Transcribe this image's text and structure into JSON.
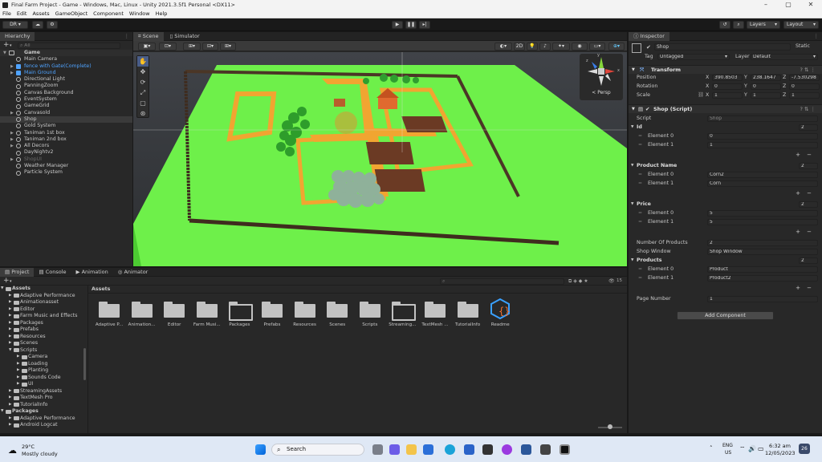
{
  "window": {
    "title": "Final Farm Project - Game - Windows, Mac, Linux - Unity 2021.3.5f1 Personal <DX11>"
  },
  "menu": [
    "File",
    "Edit",
    "Assets",
    "GameObject",
    "Component",
    "Window",
    "Help"
  ],
  "toolbar": {
    "account": "DR",
    "layers": "Layers",
    "layout": "Layout"
  },
  "hierarchy": {
    "tab": "Hierarchy",
    "search_placeholder": "All",
    "scene": "Game",
    "items": [
      {
        "label": "Main Camera",
        "style": "normal",
        "arrow": false
      },
      {
        "label": "fence with Gate(Complete)",
        "style": "blue",
        "arrow": true
      },
      {
        "label": "Main Ground",
        "style": "blue",
        "arrow": true
      },
      {
        "label": "Directional Light",
        "style": "normal",
        "arrow": false
      },
      {
        "label": "PanningZoom",
        "style": "normal",
        "arrow": false
      },
      {
        "label": "Canvas Background",
        "style": "normal",
        "arrow": false
      },
      {
        "label": "EventSystem",
        "style": "normal",
        "arrow": false
      },
      {
        "label": "GameGrid",
        "style": "normal",
        "arrow": false
      },
      {
        "label": "Canvasold",
        "style": "normal",
        "arrow": true
      },
      {
        "label": "Shop",
        "style": "selected",
        "arrow": false
      },
      {
        "label": "Gold System",
        "style": "normal",
        "arrow": false
      },
      {
        "label": "Taniman 1st box",
        "style": "normal",
        "arrow": true
      },
      {
        "label": "Taniman 2nd box",
        "style": "normal",
        "arrow": true
      },
      {
        "label": "All Decors",
        "style": "normal",
        "arrow": true
      },
      {
        "label": "DayNightv2",
        "style": "normal",
        "arrow": false
      },
      {
        "label": "ShopUI",
        "style": "dim",
        "arrow": true
      },
      {
        "label": "Weather Manager",
        "style": "normal",
        "arrow": false
      },
      {
        "label": "Particle System",
        "style": "normal",
        "arrow": false
      }
    ]
  },
  "scene_view": {
    "tabs": [
      "Scene",
      "Simulator"
    ],
    "mode_2d": "2D",
    "persp": "< Persp",
    "gizmo_axes": {
      "x": "x",
      "y": "y",
      "z": "z"
    }
  },
  "inspector": {
    "tab": "Inspector",
    "object_name": "Shop",
    "static_label": "Static",
    "tag_label": "Tag",
    "tag": "Untagged",
    "layer_label": "Layer",
    "layer": "Default",
    "transform": {
      "title": "Transform",
      "position_label": "Position",
      "rotation_label": "Rotation",
      "scale_label": "Scale",
      "position": {
        "x": "390.8503",
        "y": "238.1647",
        "z": "-7.530298"
      },
      "rotation": {
        "x": "0",
        "y": "0",
        "z": "0"
      },
      "scale": {
        "x": "1",
        "y": "1",
        "z": "1"
      }
    },
    "script_comp": {
      "title": "Shop (Script)",
      "script_label": "Script",
      "script_value": "Shop",
      "id_label": "Id",
      "id_count": "2",
      "id_elements": [
        {
          "label": "Element 0",
          "value": "0"
        },
        {
          "label": "Element 1",
          "value": "1"
        }
      ],
      "product_name_label": "Product Name",
      "product_name_count": "2",
      "product_name_elements": [
        {
          "label": "Element 0",
          "value": "Corn2"
        },
        {
          "label": "Element 1",
          "value": "Corn"
        }
      ],
      "price_label": "Price",
      "price_count": "2",
      "price_elements": [
        {
          "label": "Element 0",
          "value": "5"
        },
        {
          "label": "Element 1",
          "value": "5"
        }
      ],
      "num_products_label": "Number Of Products",
      "num_products": "2",
      "shop_window_label": "Shop Window",
      "shop_window": "Shop Window",
      "products_label": "Products",
      "products_count": "2",
      "products_elements": [
        {
          "label": "Element 0",
          "value": "Product"
        },
        {
          "label": "Element 1",
          "value": "Product2"
        }
      ],
      "page_number_label": "Page Number",
      "page_number": "1"
    },
    "add_component": "Add Component"
  },
  "project": {
    "tabs": [
      "Project",
      "Console",
      "Animation",
      "Animator"
    ],
    "badge": "15",
    "breadcrumb": "Assets",
    "tree": [
      {
        "label": "Assets",
        "indent": 0,
        "open": true
      },
      {
        "label": "Adaptive Performance",
        "indent": 1
      },
      {
        "label": "Animationasset",
        "indent": 1
      },
      {
        "label": "Editor",
        "indent": 1
      },
      {
        "label": "Farm Music and Effects",
        "indent": 1
      },
      {
        "label": "Packages",
        "indent": 1
      },
      {
        "label": "Prefabs",
        "indent": 1
      },
      {
        "label": "Resources",
        "indent": 1
      },
      {
        "label": "Scenes",
        "indent": 1
      },
      {
        "label": "Scripts",
        "indent": 1,
        "open": true
      },
      {
        "label": "Camera",
        "indent": 2
      },
      {
        "label": "Loading",
        "indent": 2
      },
      {
        "label": "Planting",
        "indent": 2
      },
      {
        "label": "Sounds Code",
        "indent": 2
      },
      {
        "label": "UI",
        "indent": 2
      },
      {
        "label": "StreamingAssets",
        "indent": 1
      },
      {
        "label": "TextMesh Pro",
        "indent": 1
      },
      {
        "label": "TutorialInfo",
        "indent": 1
      },
      {
        "label": "Packages",
        "indent": 0,
        "open": true
      },
      {
        "label": "Adaptive Performance",
        "indent": 1
      },
      {
        "label": "Android Logcat",
        "indent": 1
      }
    ],
    "assets": [
      {
        "label": "Adaptive P...",
        "kind": "folder"
      },
      {
        "label": "Animation...",
        "kind": "folder"
      },
      {
        "label": "Editor",
        "kind": "folder"
      },
      {
        "label": "Farm Musi...",
        "kind": "folder"
      },
      {
        "label": "Packages",
        "kind": "open"
      },
      {
        "label": "Prefabs",
        "kind": "folder"
      },
      {
        "label": "Resources",
        "kind": "folder"
      },
      {
        "label": "Scenes",
        "kind": "folder"
      },
      {
        "label": "Scripts",
        "kind": "folder"
      },
      {
        "label": "Streaming...",
        "kind": "open"
      },
      {
        "label": "TextMesh ...",
        "kind": "folder"
      },
      {
        "label": "TutorialInfo",
        "kind": "folder"
      },
      {
        "label": "Readme",
        "kind": "readme"
      }
    ]
  },
  "taskbar": {
    "weather_temp": "29°C",
    "weather_desc": "Mostly cloudy",
    "search": "Search",
    "lang1": "ENG",
    "lang2": "US",
    "time": "6:32 am",
    "date": "12/05/2023",
    "notif": "26"
  },
  "colors": {
    "ground": "#6ef04a",
    "path": "#f1a531",
    "soil": "#6b3a24",
    "fence": "#5a3d2a",
    "accent": "#4fa3ff"
  }
}
